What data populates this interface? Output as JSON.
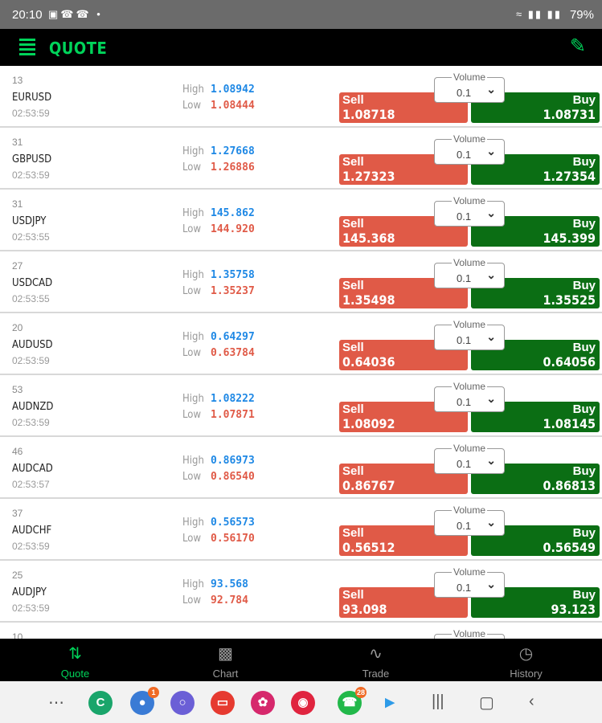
{
  "status": {
    "time": "20:10",
    "battery": "79%"
  },
  "appbar": {
    "title": "QUOTE"
  },
  "labels": {
    "high": "High",
    "low": "Low",
    "sell": "Sell",
    "buy": "Buy",
    "volume": "Volume"
  },
  "quotes": [
    {
      "spread": "13",
      "symbol": "EURUSD",
      "time": "02:53:59",
      "high": "1.08942",
      "low": "1.08444",
      "sell": "1.08718",
      "buy": "1.08731",
      "volume": "0.1"
    },
    {
      "spread": "31",
      "symbol": "GBPUSD",
      "time": "02:53:59",
      "high": "1.27668",
      "low": "1.26886",
      "sell": "1.27323",
      "buy": "1.27354",
      "volume": "0.1"
    },
    {
      "spread": "31",
      "symbol": "USDJPY",
      "time": "02:53:55",
      "high": "145.862",
      "low": "144.920",
      "sell": "145.368",
      "buy": "145.399",
      "volume": "0.1"
    },
    {
      "spread": "27",
      "symbol": "USDCAD",
      "time": "02:53:55",
      "high": "1.35758",
      "low": "1.35237",
      "sell": "1.35498",
      "buy": "1.35525",
      "volume": "0.1"
    },
    {
      "spread": "20",
      "symbol": "AUDUSD",
      "time": "02:53:59",
      "high": "0.64297",
      "low": "0.63784",
      "sell": "0.64036",
      "buy": "0.64056",
      "volume": "0.1"
    },
    {
      "spread": "53",
      "symbol": "AUDNZD",
      "time": "02:53:59",
      "high": "1.08222",
      "low": "1.07871",
      "sell": "1.08092",
      "buy": "1.08145",
      "volume": "0.1"
    },
    {
      "spread": "46",
      "symbol": "AUDCAD",
      "time": "02:53:57",
      "high": "0.86973",
      "low": "0.86540",
      "sell": "0.86767",
      "buy": "0.86813",
      "volume": "0.1"
    },
    {
      "spread": "37",
      "symbol": "AUDCHF",
      "time": "02:53:59",
      "high": "0.56573",
      "low": "0.56170",
      "sell": "0.56512",
      "buy": "0.56549",
      "volume": "0.1"
    },
    {
      "spread": "25",
      "symbol": "AUDJPY",
      "time": "02:53:59",
      "high": "93.568",
      "low": "92.784",
      "sell": "93.098",
      "buy": "93.123",
      "volume": "0.1"
    },
    {
      "spread": "10",
      "symbol": "",
      "time": "",
      "high": "",
      "low": "",
      "sell": "",
      "buy": "",
      "volume": ""
    }
  ],
  "tabs": [
    {
      "label": "Quote",
      "icon": "quote-arrows-icon",
      "active": true
    },
    {
      "label": "Chart",
      "icon": "chart-icon",
      "active": false
    },
    {
      "label": "Trade",
      "icon": "trade-line-icon",
      "active": false
    },
    {
      "label": "History",
      "icon": "history-clock-icon",
      "active": false
    }
  ],
  "dock": {
    "message_badge": "1",
    "whatsapp_badge": "28",
    "colors": {
      "accent": "#00d45a",
      "sell": "#e05a47",
      "buy": "#0b6e14",
      "high": "#1e88e5"
    }
  }
}
